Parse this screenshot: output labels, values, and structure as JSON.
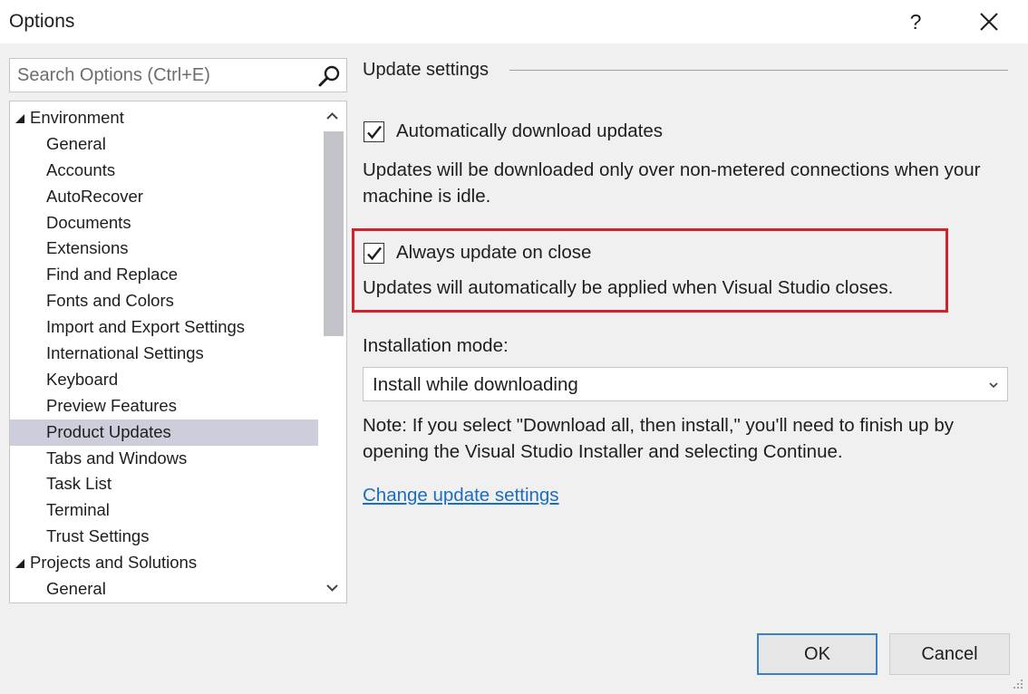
{
  "window": {
    "title": "Options",
    "help_label": "?"
  },
  "search": {
    "placeholder": "Search Options (Ctrl+E)",
    "value": ""
  },
  "tree": {
    "items": [
      {
        "label": "Environment",
        "level": 0,
        "expanded": true
      },
      {
        "label": "General",
        "level": 1
      },
      {
        "label": "Accounts",
        "level": 1
      },
      {
        "label": "AutoRecover",
        "level": 1
      },
      {
        "label": "Documents",
        "level": 1
      },
      {
        "label": "Extensions",
        "level": 1
      },
      {
        "label": "Find and Replace",
        "level": 1
      },
      {
        "label": "Fonts and Colors",
        "level": 1
      },
      {
        "label": "Import and Export Settings",
        "level": 1
      },
      {
        "label": "International Settings",
        "level": 1
      },
      {
        "label": "Keyboard",
        "level": 1
      },
      {
        "label": "Preview Features",
        "level": 1
      },
      {
        "label": "Product Updates",
        "level": 1,
        "selected": true
      },
      {
        "label": "Tabs and Windows",
        "level": 1
      },
      {
        "label": "Task List",
        "level": 1
      },
      {
        "label": "Terminal",
        "level": 1
      },
      {
        "label": "Trust Settings",
        "level": 1
      },
      {
        "label": "Projects and Solutions",
        "level": 0,
        "expanded": true
      },
      {
        "label": "General",
        "level": 1
      }
    ]
  },
  "settings": {
    "section_title": "Update settings",
    "auto_download": {
      "label": "Automatically download updates",
      "checked": true,
      "description": "Updates will be downloaded only over non-metered connections when your machine is idle."
    },
    "update_on_close": {
      "label": "Always update on close",
      "checked": true,
      "description": "Updates will automatically be applied when Visual Studio closes."
    },
    "installation_mode": {
      "label": "Installation mode:",
      "value": "Install while downloading"
    },
    "note": "Note: If you select \"Download all, then install,\" you'll need to finish up by opening the Visual Studio Installer and selecting Continue.",
    "link_text": "Change update settings"
  },
  "buttons": {
    "ok": "OK",
    "cancel": "Cancel"
  },
  "colors": {
    "highlight": "#d0242c",
    "link": "#1a6dc2",
    "selected_row": "#cccedb"
  },
  "icons": [
    "search-icon",
    "close-icon",
    "checkmark-icon",
    "chevron-down-icon",
    "chevron-up-icon",
    "expand-triangle-icon",
    "resize-grip-icon"
  ]
}
